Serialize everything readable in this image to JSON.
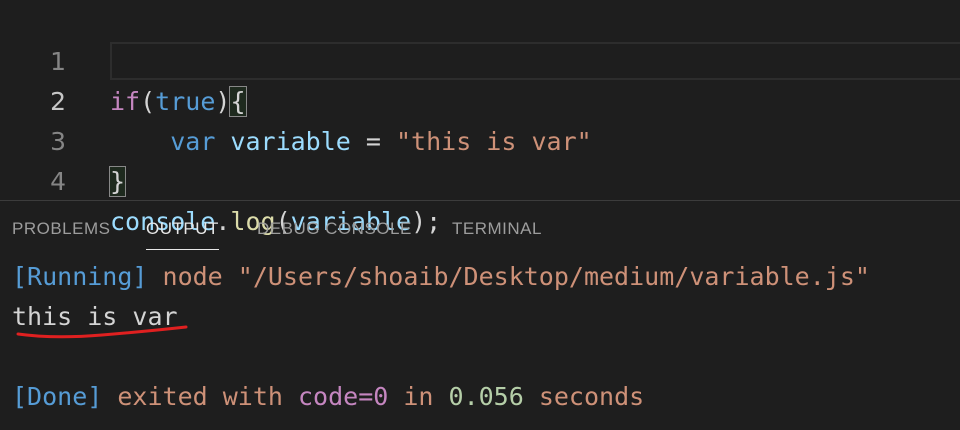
{
  "editor": {
    "lines": [
      {
        "num": "1",
        "tokens": {
          "if": "if",
          "open": "(",
          "true": "true",
          "close": ")",
          "brace": "{"
        }
      },
      {
        "num": "2",
        "tokens": {
          "indent": "    ",
          "var": "var",
          "name": " variable",
          "eq": " = ",
          "str": "\"this is var\""
        }
      },
      {
        "num": "3",
        "tokens": {
          "brace": "}"
        }
      },
      {
        "num": "4",
        "tokens": {
          "console": "console",
          "dot": ".",
          "log": "log",
          "open": "(",
          "arg": "variable",
          "close": ")",
          "semi": ";"
        }
      }
    ]
  },
  "panel": {
    "tabs": [
      {
        "label": "PROBLEMS"
      },
      {
        "label": "OUTPUT"
      },
      {
        "label": "DEBUG CONSOLE"
      },
      {
        "label": "TERMINAL"
      }
    ],
    "active_tab": "OUTPUT"
  },
  "output": {
    "running_tag": "[Running]",
    "running_cmd": " node \"/Users/shoaib/Desktop/medium/variable.js\"",
    "result": "this is var",
    "done_tag": "[Done]",
    "done_text1": " exited with ",
    "done_code": "code=0",
    "done_text2": " in ",
    "done_time": "0.056",
    "done_text3": " seconds"
  },
  "colors": {
    "background": "#1e1e1e",
    "keyword": "#c586c0",
    "constant": "#569cd6",
    "identifier": "#9cdcfe",
    "string": "#ce9178",
    "function": "#dcdcaa",
    "annotation_red": "#e02020"
  }
}
